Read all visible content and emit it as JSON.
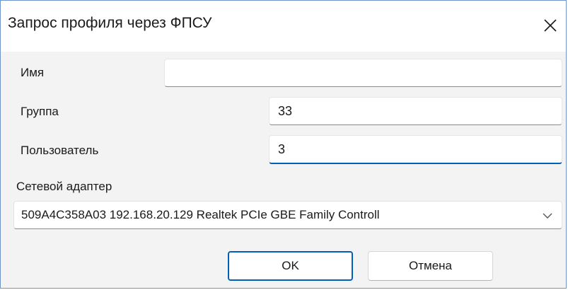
{
  "window": {
    "title": "Запрос профиля через ФПСУ",
    "close_icon": "close-icon"
  },
  "form": {
    "name_label": "Имя",
    "name_value": "",
    "group_label": "Группа",
    "group_value": "33",
    "user_label": "Пользователь",
    "user_value": "3",
    "adapter_label": "Сетевой адаптер",
    "adapter_value": "509A4C358A03 192.168.20.129 Realtek PCIe GBE Family Controll",
    "adapter_arrow_icon": "chevron-down-icon"
  },
  "buttons": {
    "ok_label": "OK",
    "cancel_label": "Отмена"
  },
  "colors": {
    "accent": "#005fb8",
    "window_border": "#6d95c9",
    "background": "#f3f3f3"
  }
}
